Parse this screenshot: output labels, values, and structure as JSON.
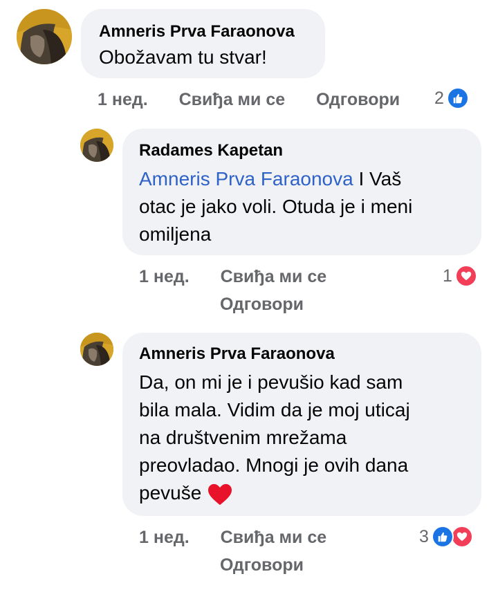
{
  "comments": [
    {
      "author": "Amneris Prva Faraonova",
      "text": "Obožavam tu stvar!",
      "time": "1 нед.",
      "like": "Свиђа ми се",
      "reply": "Одговори",
      "reaction_count": "2",
      "reactions": [
        "like-icon"
      ]
    },
    {
      "author": "Radames Kapetan",
      "mention": "Amneris Prva Faraonova",
      "text_line1": " I Vaš",
      "text_line2": "otac je jako voli. Otuda je i meni",
      "text_line3": "omiljena",
      "time": "1 нед.",
      "like": "Свиђа ми се",
      "reply": "Одговори",
      "reaction_count": "1",
      "reactions": [
        "love-icon"
      ]
    },
    {
      "author": "Amneris Prva Faraonova",
      "text_line1": "Da, on mi je i pevušio kad sam",
      "text_line2": "bila mala. Vidim da je moj uticaj",
      "text_line3": "na društvenim mrežama",
      "text_line4": "preovladao. Mnogi je ovih dana",
      "text_line5": "pevuše",
      "time": "1 нед.",
      "like": "Свиђа ми се",
      "reply": "Одговори",
      "reaction_count": "3",
      "reactions": [
        "like-icon",
        "love-icon"
      ]
    }
  ],
  "colors": {
    "bubble": "#f0f2f5",
    "meta": "#65676b",
    "mention": "#2f62c8",
    "like": "#1b74e4",
    "love": "#f33e58"
  }
}
